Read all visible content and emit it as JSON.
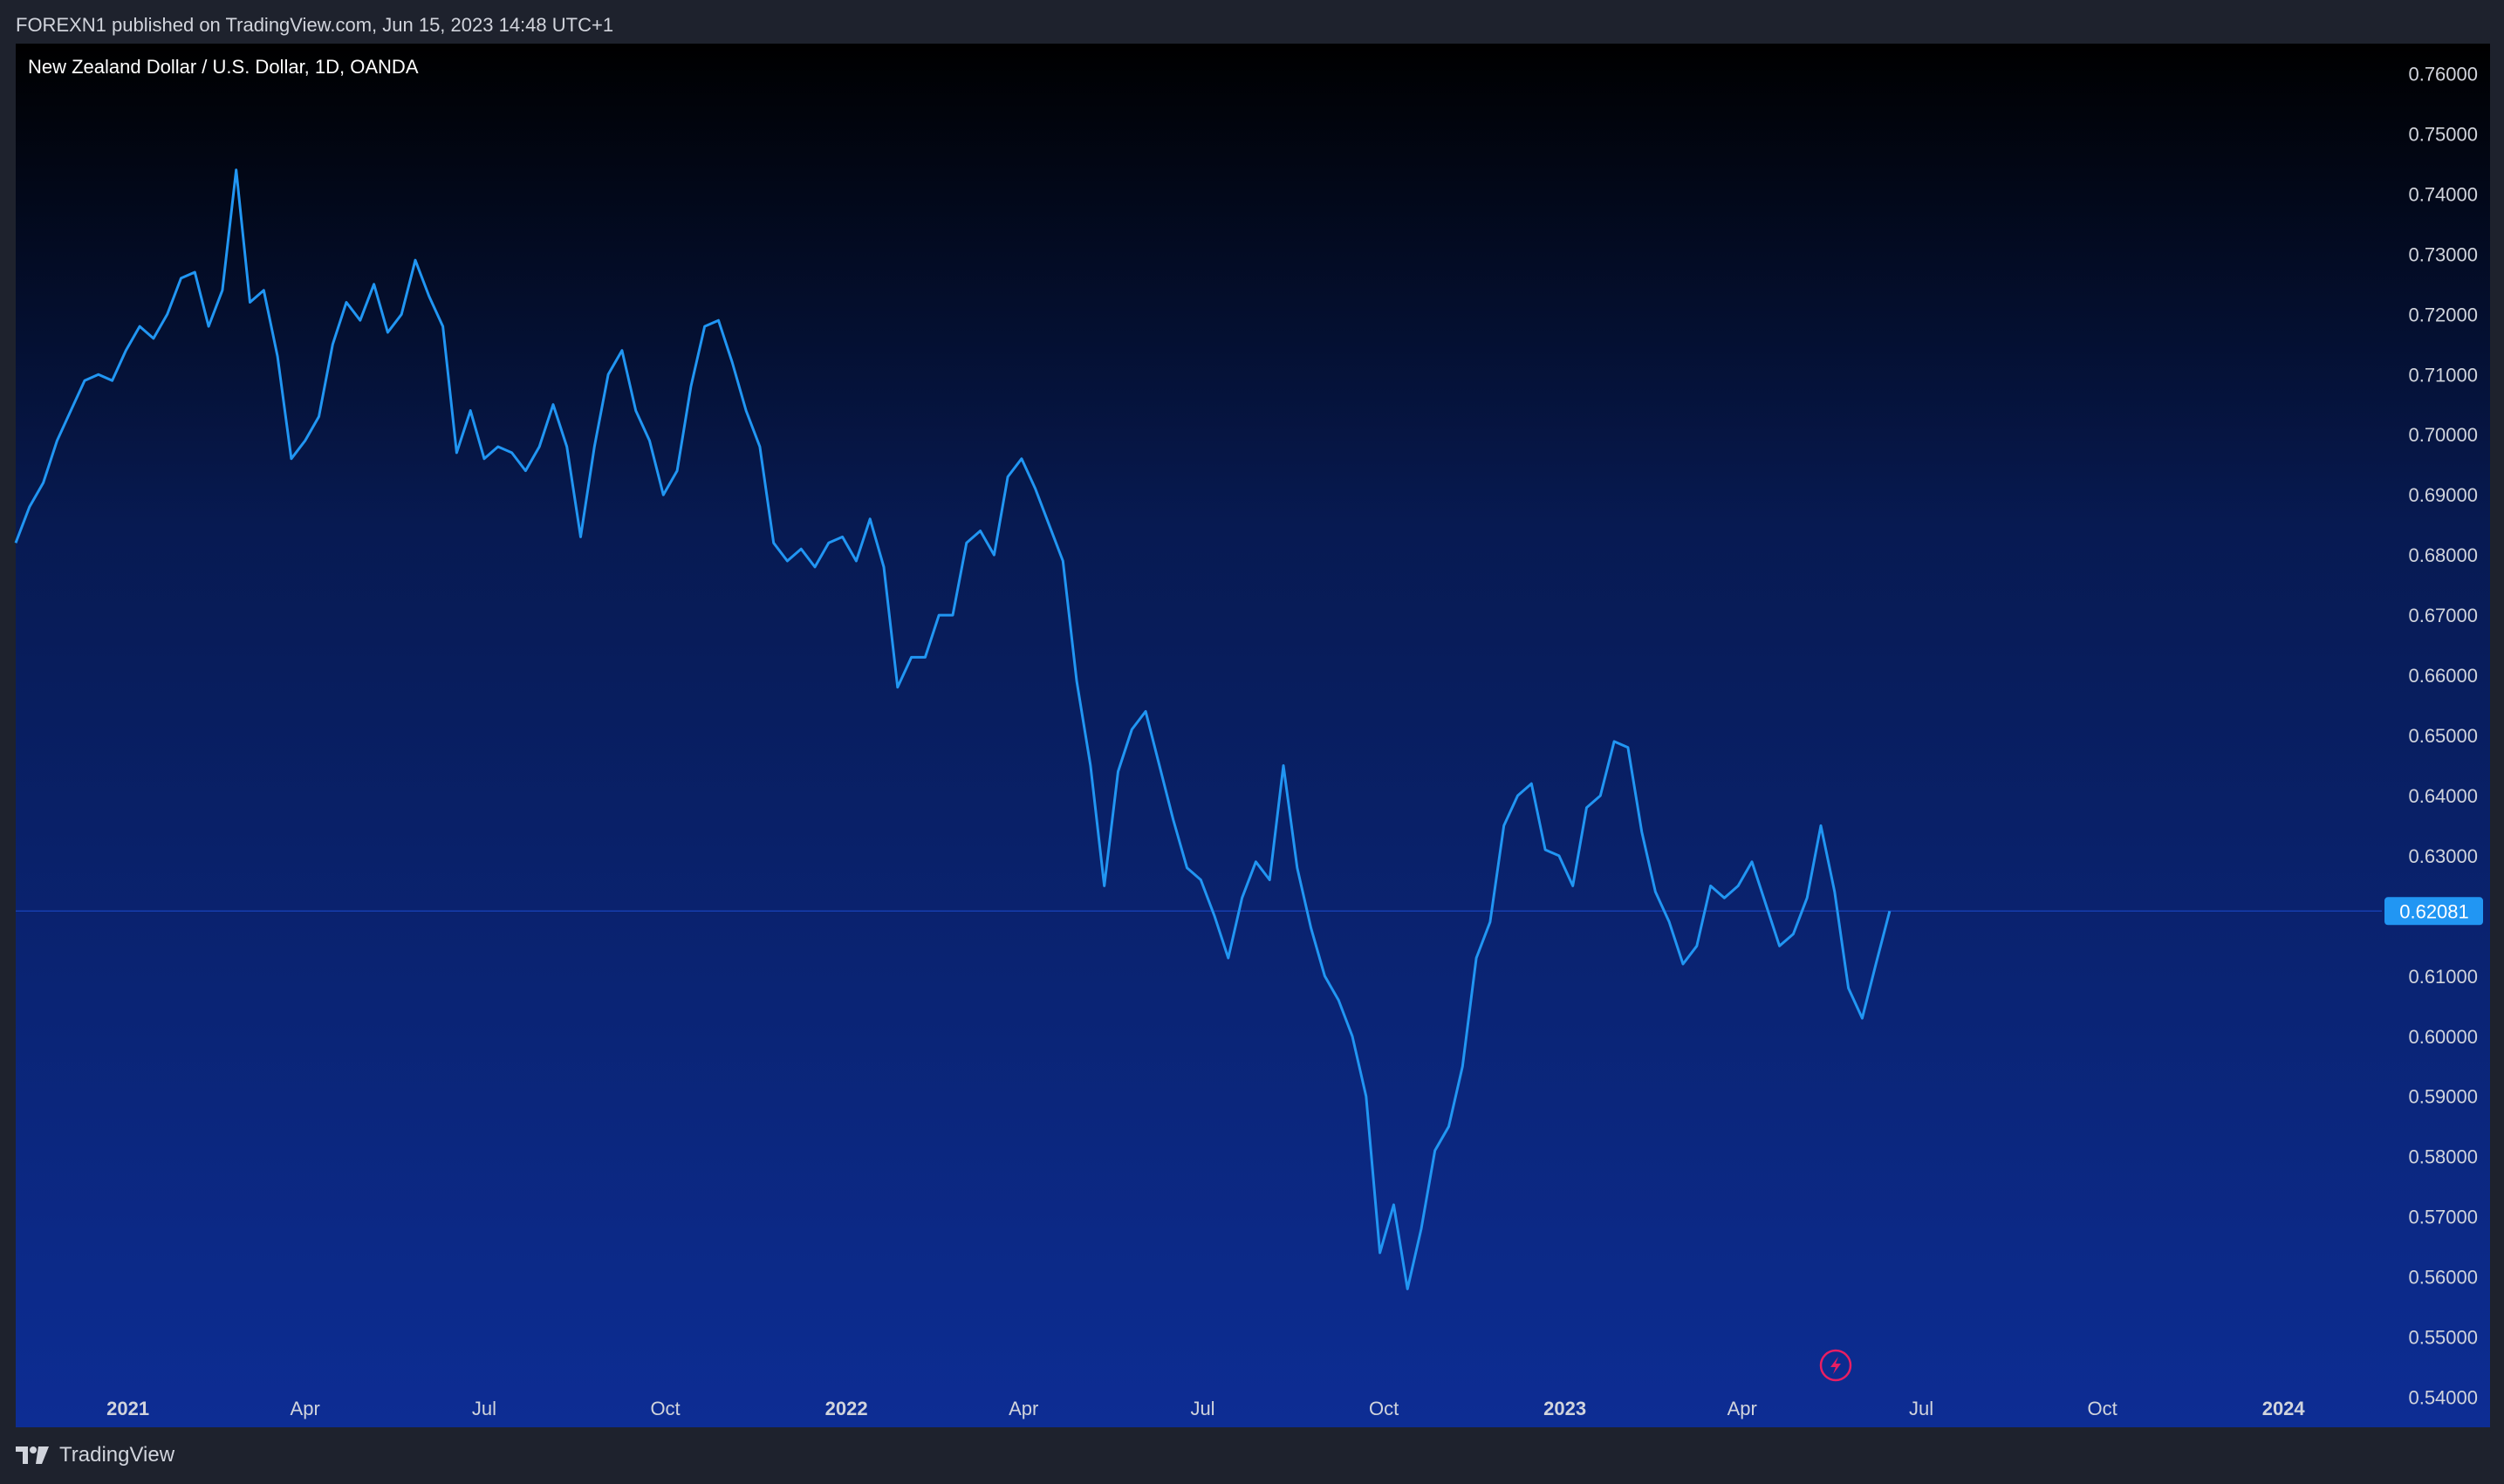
{
  "publisher_line": "FOREXN1 published on TradingView.com, Jun 15, 2023 14:48 UTC+1",
  "footer_brand": "TradingView",
  "colors": {
    "line": "#2196f3",
    "price_badge": "#2196f3",
    "bg_top": "#000000",
    "bg_bottom": "#0d2d94"
  },
  "chart_data": {
    "type": "line",
    "title": "New Zealand Dollar / U.S. Dollar, 1D, OANDA",
    "xlabel": "",
    "ylabel": "",
    "ylim": [
      0.535,
      0.765
    ],
    "xlim": [
      "2020-11-05",
      "2024-02-20"
    ],
    "grid": false,
    "last_price": "0.62081",
    "y_ticks": [
      "0.76000",
      "0.75000",
      "0.74000",
      "0.73000",
      "0.72000",
      "0.71000",
      "0.70000",
      "0.69000",
      "0.68000",
      "0.67000",
      "0.66000",
      "0.65000",
      "0.64000",
      "0.63000",
      "0.62000",
      "0.61000",
      "0.60000",
      "0.59000",
      "0.58000",
      "0.57000",
      "0.56000",
      "0.55000",
      "0.54000"
    ],
    "x_ticks": [
      {
        "label": "2021",
        "date": "2021-01-01",
        "bold": true
      },
      {
        "label": "Apr",
        "date": "2021-04-01",
        "bold": false
      },
      {
        "label": "Jul",
        "date": "2021-07-01",
        "bold": false
      },
      {
        "label": "Oct",
        "date": "2021-10-01",
        "bold": false
      },
      {
        "label": "2022",
        "date": "2022-01-01",
        "bold": true
      },
      {
        "label": "Apr",
        "date": "2022-04-01",
        "bold": false
      },
      {
        "label": "Jul",
        "date": "2022-07-01",
        "bold": false
      },
      {
        "label": "Oct",
        "date": "2022-10-01",
        "bold": false
      },
      {
        "label": "2023",
        "date": "2023-01-01",
        "bold": true
      },
      {
        "label": "Apr",
        "date": "2023-04-01",
        "bold": false
      },
      {
        "label": "Jul",
        "date": "2023-07-01",
        "bold": false
      },
      {
        "label": "Oct",
        "date": "2023-10-01",
        "bold": false
      },
      {
        "label": "2024",
        "date": "2024-01-01",
        "bold": true
      }
    ],
    "series": [
      {
        "values": [
          [
            "2020-11-05",
            0.682
          ],
          [
            "2020-11-12",
            0.688
          ],
          [
            "2020-11-19",
            0.692
          ],
          [
            "2020-11-26",
            0.699
          ],
          [
            "2020-12-03",
            0.704
          ],
          [
            "2020-12-10",
            0.709
          ],
          [
            "2020-12-17",
            0.71
          ],
          [
            "2020-12-24",
            0.709
          ],
          [
            "2020-12-31",
            0.714
          ],
          [
            "2021-01-07",
            0.718
          ],
          [
            "2021-01-14",
            0.716
          ],
          [
            "2021-01-21",
            0.72
          ],
          [
            "2021-01-28",
            0.726
          ],
          [
            "2021-02-04",
            0.727
          ],
          [
            "2021-02-11",
            0.718
          ],
          [
            "2021-02-18",
            0.724
          ],
          [
            "2021-02-25",
            0.744
          ],
          [
            "2021-03-04",
            0.722
          ],
          [
            "2021-03-11",
            0.724
          ],
          [
            "2021-03-18",
            0.713
          ],
          [
            "2021-03-25",
            0.696
          ],
          [
            "2021-04-01",
            0.699
          ],
          [
            "2021-04-08",
            0.703
          ],
          [
            "2021-04-15",
            0.715
          ],
          [
            "2021-04-22",
            0.722
          ],
          [
            "2021-04-29",
            0.719
          ],
          [
            "2021-05-06",
            0.725
          ],
          [
            "2021-05-13",
            0.717
          ],
          [
            "2021-05-20",
            0.72
          ],
          [
            "2021-05-27",
            0.729
          ],
          [
            "2021-06-03",
            0.723
          ],
          [
            "2021-06-10",
            0.718
          ],
          [
            "2021-06-17",
            0.697
          ],
          [
            "2021-06-24",
            0.704
          ],
          [
            "2021-07-01",
            0.696
          ],
          [
            "2021-07-08",
            0.698
          ],
          [
            "2021-07-15",
            0.697
          ],
          [
            "2021-07-22",
            0.694
          ],
          [
            "2021-07-29",
            0.698
          ],
          [
            "2021-08-05",
            0.705
          ],
          [
            "2021-08-12",
            0.698
          ],
          [
            "2021-08-19",
            0.683
          ],
          [
            "2021-08-26",
            0.698
          ],
          [
            "2021-09-02",
            0.71
          ],
          [
            "2021-09-09",
            0.714
          ],
          [
            "2021-09-16",
            0.704
          ],
          [
            "2021-09-23",
            0.699
          ],
          [
            "2021-09-30",
            0.69
          ],
          [
            "2021-10-07",
            0.694
          ],
          [
            "2021-10-14",
            0.708
          ],
          [
            "2021-10-21",
            0.718
          ],
          [
            "2021-10-28",
            0.719
          ],
          [
            "2021-11-04",
            0.712
          ],
          [
            "2021-11-11",
            0.704
          ],
          [
            "2021-11-18",
            0.698
          ],
          [
            "2021-11-25",
            0.682
          ],
          [
            "2021-12-02",
            0.679
          ],
          [
            "2021-12-09",
            0.681
          ],
          [
            "2021-12-16",
            0.678
          ],
          [
            "2021-12-23",
            0.682
          ],
          [
            "2021-12-30",
            0.683
          ],
          [
            "2022-01-06",
            0.679
          ],
          [
            "2022-01-13",
            0.686
          ],
          [
            "2022-01-20",
            0.678
          ],
          [
            "2022-01-27",
            0.658
          ],
          [
            "2022-02-03",
            0.663
          ],
          [
            "2022-02-10",
            0.663
          ],
          [
            "2022-02-17",
            0.67
          ],
          [
            "2022-02-24",
            0.67
          ],
          [
            "2022-03-03",
            0.682
          ],
          [
            "2022-03-10",
            0.684
          ],
          [
            "2022-03-17",
            0.68
          ],
          [
            "2022-03-24",
            0.693
          ],
          [
            "2022-03-31",
            0.696
          ],
          [
            "2022-04-07",
            0.691
          ],
          [
            "2022-04-14",
            0.685
          ],
          [
            "2022-04-21",
            0.679
          ],
          [
            "2022-04-28",
            0.659
          ],
          [
            "2022-05-05",
            0.645
          ],
          [
            "2022-05-12",
            0.625
          ],
          [
            "2022-05-19",
            0.644
          ],
          [
            "2022-05-26",
            0.651
          ],
          [
            "2022-06-02",
            0.654
          ],
          [
            "2022-06-09",
            0.645
          ],
          [
            "2022-06-16",
            0.636
          ],
          [
            "2022-06-23",
            0.628
          ],
          [
            "2022-06-30",
            0.626
          ],
          [
            "2022-07-07",
            0.62
          ],
          [
            "2022-07-14",
            0.613
          ],
          [
            "2022-07-21",
            0.623
          ],
          [
            "2022-07-28",
            0.629
          ],
          [
            "2022-08-04",
            0.626
          ],
          [
            "2022-08-11",
            0.645
          ],
          [
            "2022-08-18",
            0.628
          ],
          [
            "2022-08-25",
            0.618
          ],
          [
            "2022-09-01",
            0.61
          ],
          [
            "2022-09-08",
            0.606
          ],
          [
            "2022-09-15",
            0.6
          ],
          [
            "2022-09-22",
            0.59
          ],
          [
            "2022-09-29",
            0.564
          ],
          [
            "2022-10-06",
            0.572
          ],
          [
            "2022-10-13",
            0.558
          ],
          [
            "2022-10-20",
            0.568
          ],
          [
            "2022-10-27",
            0.581
          ],
          [
            "2022-11-03",
            0.585
          ],
          [
            "2022-11-10",
            0.595
          ],
          [
            "2022-11-17",
            0.613
          ],
          [
            "2022-11-24",
            0.619
          ],
          [
            "2022-12-01",
            0.635
          ],
          [
            "2022-12-08",
            0.64
          ],
          [
            "2022-12-15",
            0.642
          ],
          [
            "2022-12-22",
            0.631
          ],
          [
            "2022-12-29",
            0.63
          ],
          [
            "2023-01-05",
            0.625
          ],
          [
            "2023-01-12",
            0.638
          ],
          [
            "2023-01-19",
            0.64
          ],
          [
            "2023-01-26",
            0.649
          ],
          [
            "2023-02-02",
            0.648
          ],
          [
            "2023-02-09",
            0.634
          ],
          [
            "2023-02-16",
            0.624
          ],
          [
            "2023-02-23",
            0.619
          ],
          [
            "2023-03-02",
            0.612
          ],
          [
            "2023-03-09",
            0.615
          ],
          [
            "2023-03-16",
            0.625
          ],
          [
            "2023-03-23",
            0.623
          ],
          [
            "2023-03-30",
            0.625
          ],
          [
            "2023-04-06",
            0.629
          ],
          [
            "2023-04-13",
            0.622
          ],
          [
            "2023-04-20",
            0.615
          ],
          [
            "2023-04-27",
            0.617
          ],
          [
            "2023-05-04",
            0.623
          ],
          [
            "2023-05-11",
            0.635
          ],
          [
            "2023-05-18",
            0.624
          ],
          [
            "2023-05-25",
            0.608
          ],
          [
            "2023-06-01",
            0.603
          ],
          [
            "2023-06-08",
            0.612
          ],
          [
            "2023-06-15",
            0.62081
          ]
        ]
      }
    ]
  }
}
